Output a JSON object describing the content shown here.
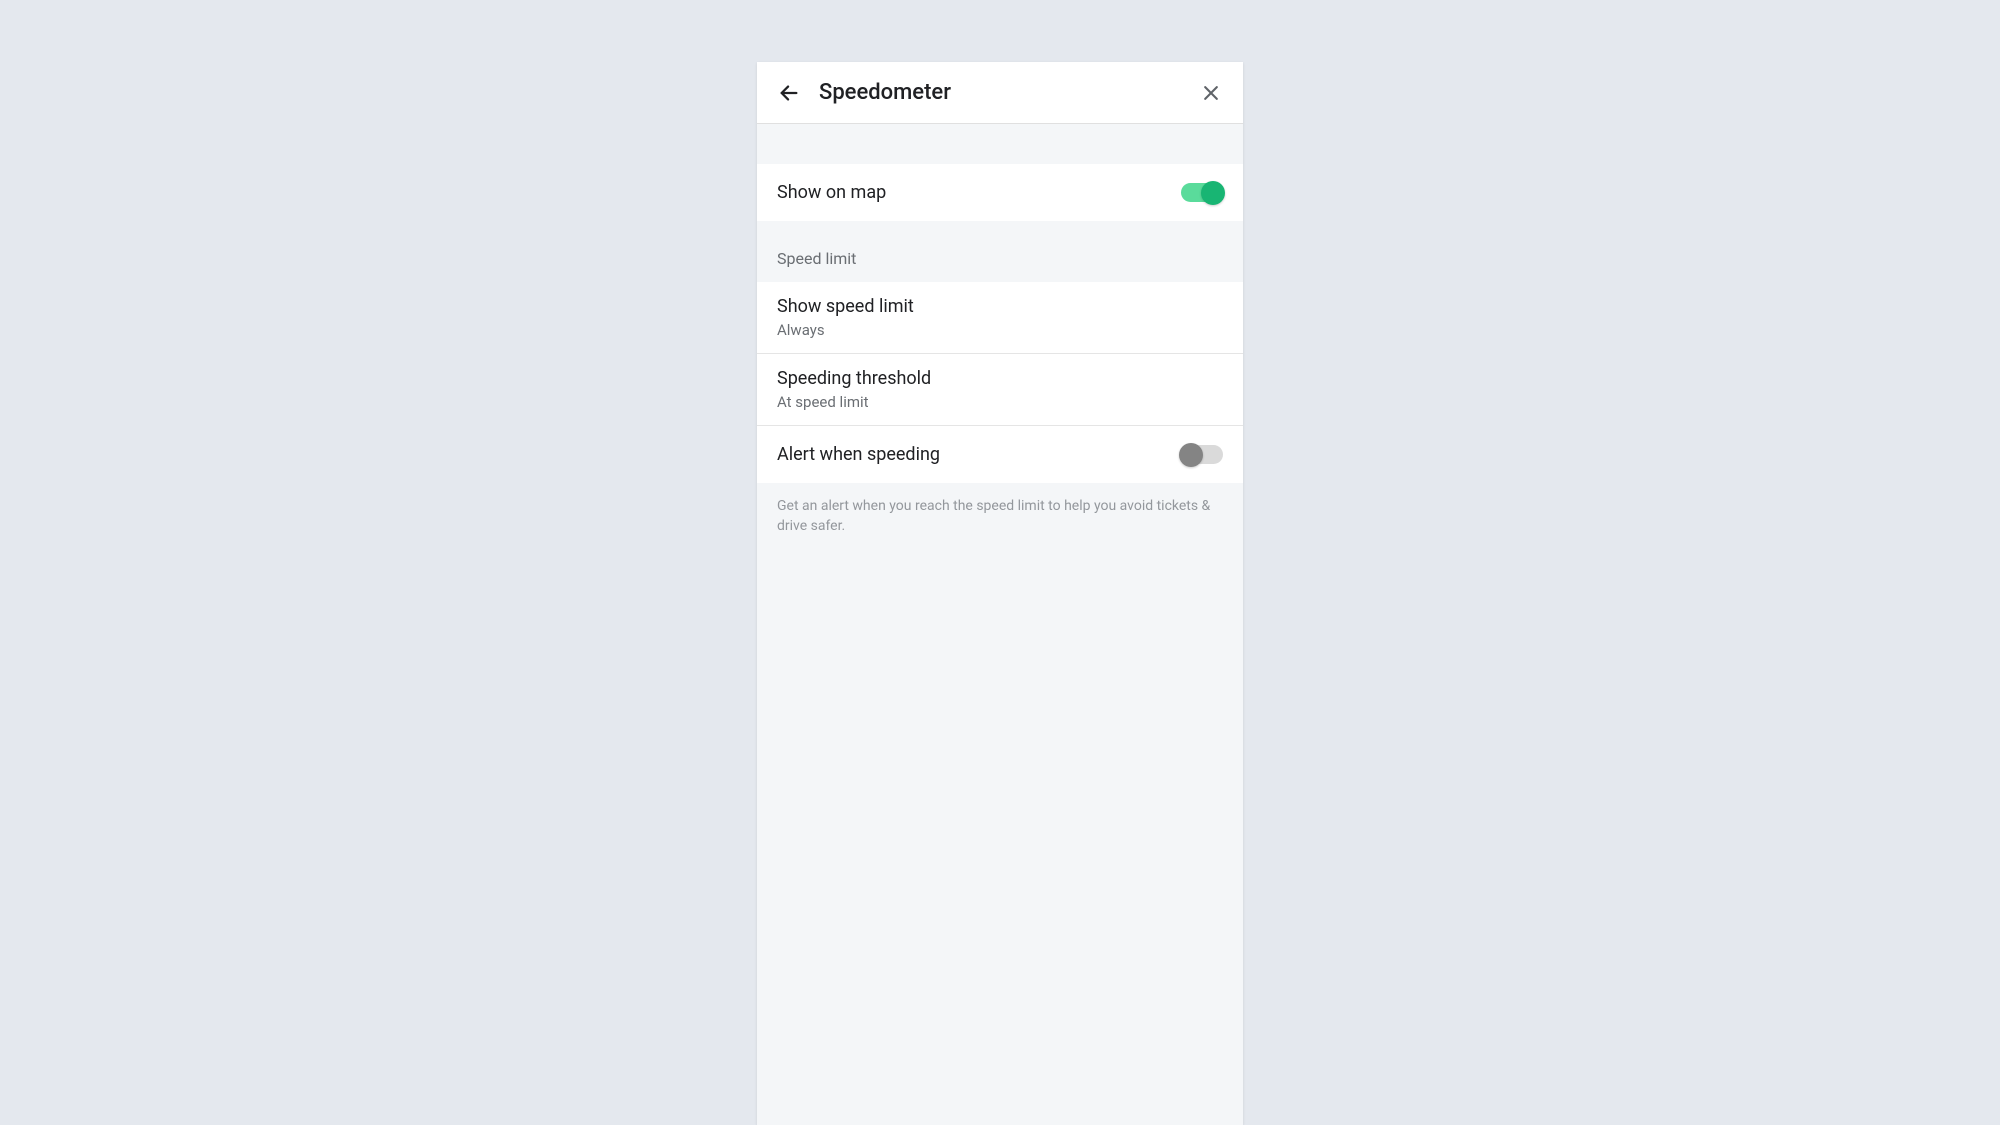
{
  "header": {
    "title": "Speedometer"
  },
  "showOnMap": {
    "label": "Show on map",
    "enabled": true
  },
  "speedLimit": {
    "sectionTitle": "Speed limit",
    "showSpeedLimit": {
      "title": "Show speed limit",
      "value": "Always"
    },
    "speedingThreshold": {
      "title": "Speeding threshold",
      "value": "At speed limit"
    },
    "alertWhenSpeeding": {
      "label": "Alert when speeding",
      "enabled": false
    }
  },
  "footerText": "Get an alert when you reach the speed limit to help you avoid tickets & drive safer."
}
